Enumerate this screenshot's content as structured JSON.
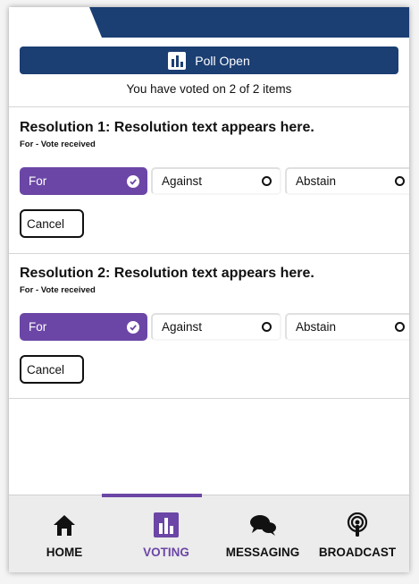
{
  "poll": {
    "banner_label": "Poll Open",
    "summary": "You have voted on 2 of 2 items"
  },
  "resolutions": [
    {
      "title": "Resolution 1: Resolution text appears here.",
      "status": "For - Vote received",
      "options": [
        "For",
        "Against",
        "Abstain"
      ],
      "selected_option": "For",
      "cancel_label": "Cancel"
    },
    {
      "title": "Resolution 2: Resolution text appears here.",
      "status": "For - Vote received",
      "options": [
        "For",
        "Against",
        "Abstain"
      ],
      "selected_option": "For",
      "cancel_label": "Cancel"
    }
  ],
  "nav": {
    "items": [
      {
        "label": "HOME",
        "icon": "home-icon"
      },
      {
        "label": "VOTING",
        "icon": "voting-icon"
      },
      {
        "label": "MESSAGING",
        "icon": "messaging-icon"
      },
      {
        "label": "BROADCAST",
        "icon": "broadcast-icon"
      }
    ],
    "active": "VOTING"
  },
  "colors": {
    "brand_navy": "#1b3e73",
    "accent_purple": "#6b46a6"
  }
}
